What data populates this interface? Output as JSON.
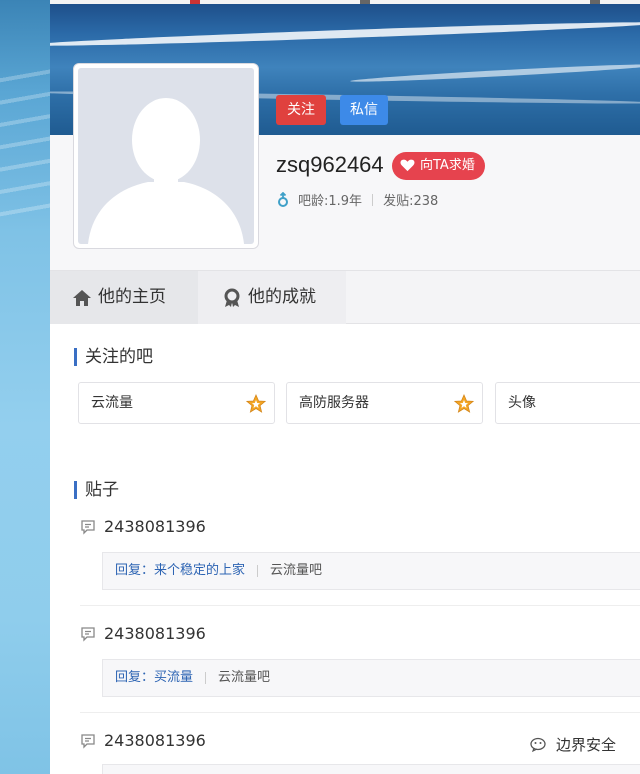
{
  "profile": {
    "username": "zsq962464",
    "follow_label": "关注",
    "message_label": "私信",
    "propose_label": "向TA求婚",
    "age_label": "吧龄:1.9年",
    "posts_label": "发贴:238"
  },
  "tabs": [
    {
      "label": "他的主页"
    },
    {
      "label": "他的成就"
    }
  ],
  "followed": {
    "title": "关注的吧",
    "items": [
      {
        "name": "云流量"
      },
      {
        "name": "高防服务器"
      },
      {
        "name": "头像"
      }
    ]
  },
  "posts": {
    "title": "贴子",
    "items": [
      {
        "id": "2438081396",
        "reply": "回复：来个稳定的上家",
        "forum": "云流量吧"
      },
      {
        "id": "2438081396",
        "reply": "回复：买流量",
        "forum": "云流量吧"
      },
      {
        "id": "2438081396"
      }
    ]
  },
  "watermark": "边界安全",
  "colors": {
    "follow_button": "#e0413e",
    "message_button": "#3d8ae8",
    "propose_badge": "#e6434e",
    "accent_bar": "#3a6fc4",
    "reply_link": "#2d64b3"
  }
}
